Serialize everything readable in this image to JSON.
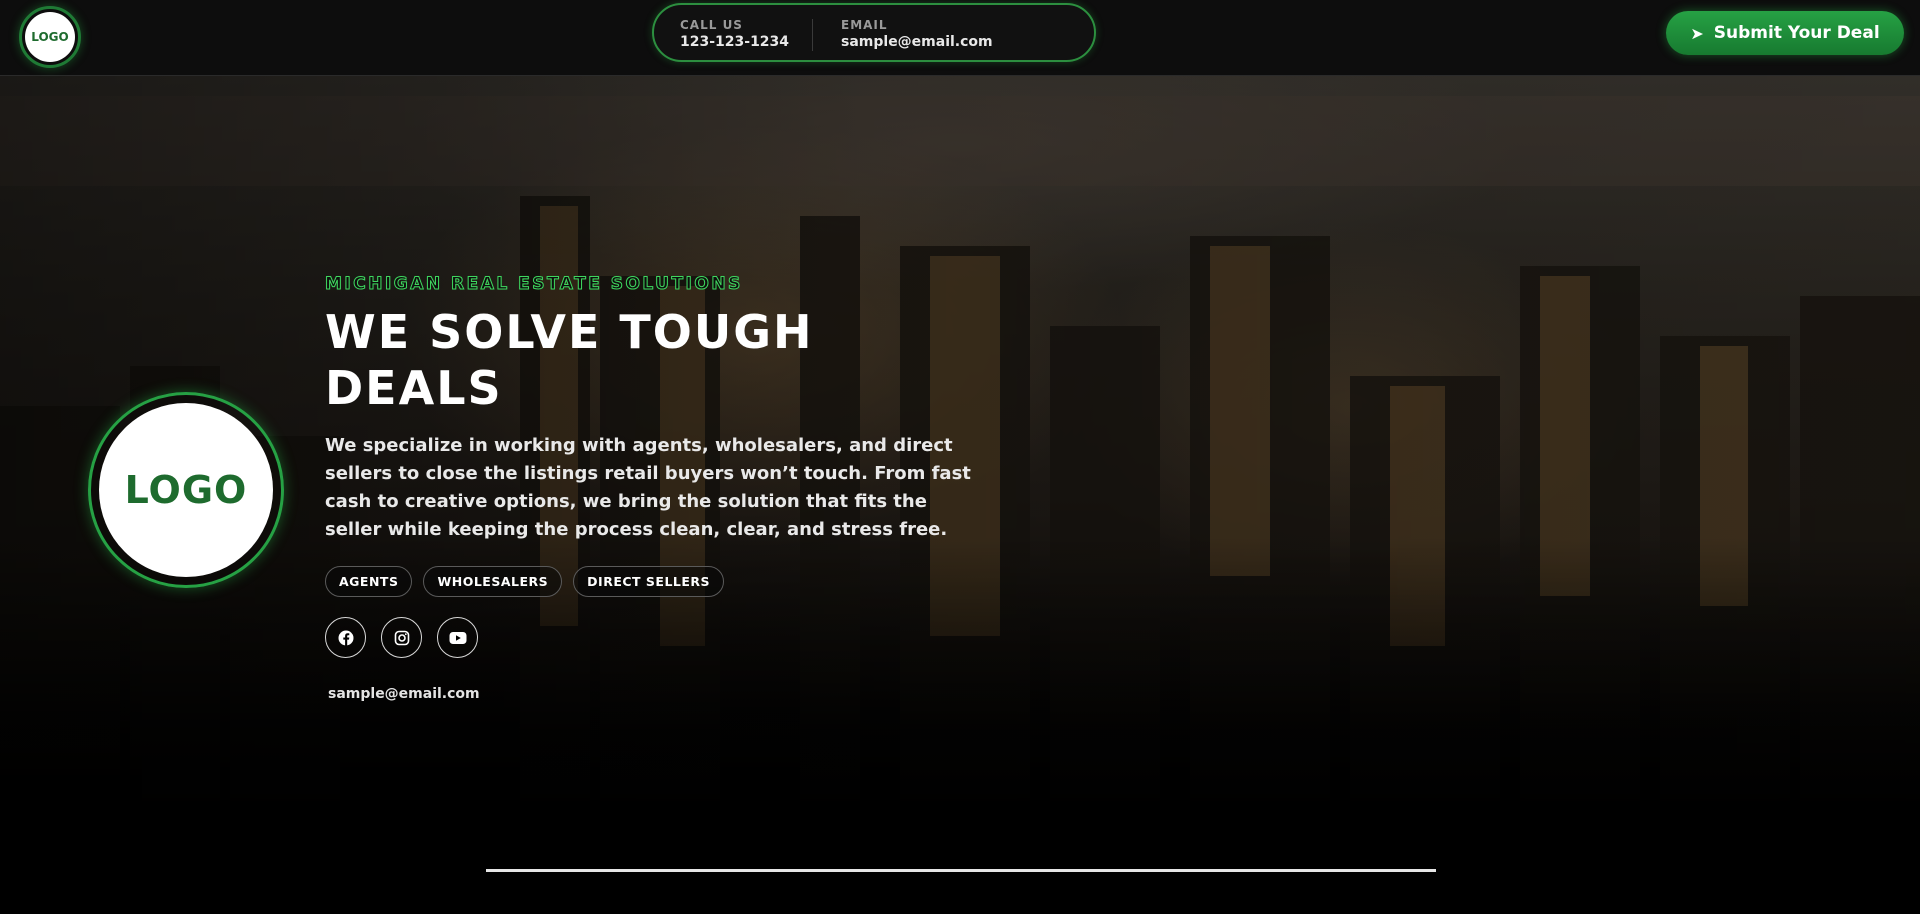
{
  "header": {
    "logo_text": "LOGO",
    "contact": {
      "phone_label": "CALL US",
      "phone_value": "123-123-1234",
      "email_label": "EMAIL",
      "email_value": "sample@email.com"
    },
    "submit_button": {
      "icon": "send-arrow-icon",
      "label": "Submit Your Deal"
    }
  },
  "hero": {
    "logo_text": "LOGO",
    "eyebrow": "MICHIGAN REAL ESTATE SOLUTIONS",
    "headline": "WE SOLVE TOUGH DEALS",
    "description": "We specialize in working with agents, wholesalers, and direct sellers to close the listings retail buyers won’t touch. From fast cash to creative options, we bring the solution that fits the seller while keeping the process clean, clear, and stress free.",
    "tags": [
      "AGENTS",
      "WHOLESALERS",
      "DIRECT SELLERS"
    ],
    "socials": [
      "facebook-icon",
      "instagram-icon",
      "youtube-icon"
    ],
    "email": "sample@email.com"
  },
  "colors": {
    "accent_green": "#26a144",
    "header_bg": "#0d0d0d",
    "eyebrow_outline": "#3ed65e",
    "logo_text": "#1e6b2e"
  }
}
